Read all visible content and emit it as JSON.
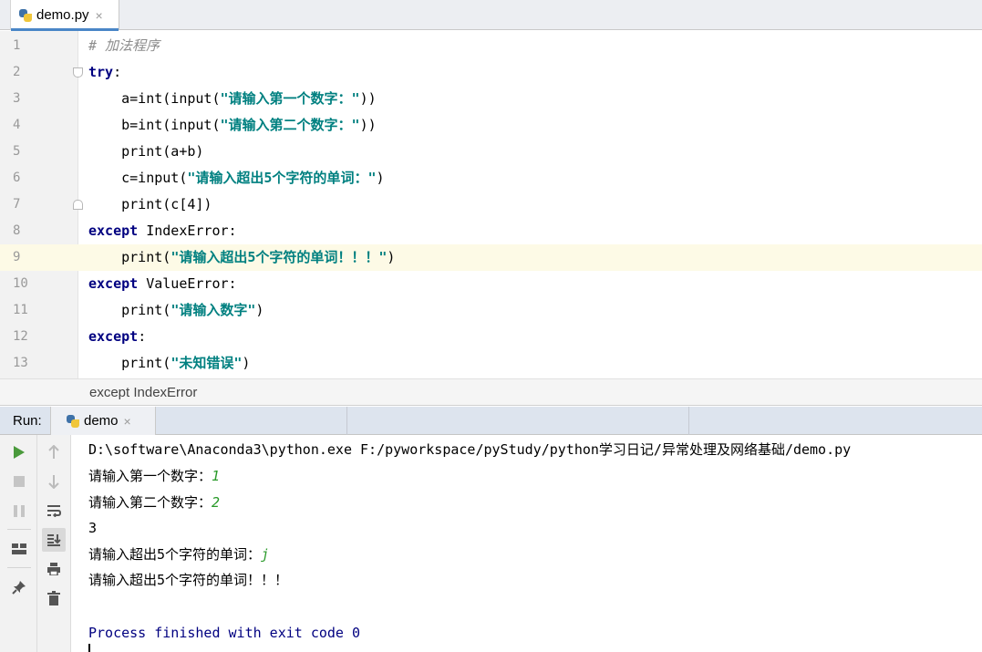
{
  "editor_tab": {
    "label": "demo.py",
    "close": "×"
  },
  "editor": {
    "lines": [
      {
        "n": "1"
      },
      {
        "n": "2"
      },
      {
        "n": "3"
      },
      {
        "n": "4"
      },
      {
        "n": "5"
      },
      {
        "n": "6"
      },
      {
        "n": "7"
      },
      {
        "n": "8"
      },
      {
        "n": "9"
      },
      {
        "n": "10"
      },
      {
        "n": "11"
      },
      {
        "n": "12"
      },
      {
        "n": "13"
      }
    ],
    "code": {
      "l1_comment": "# 加法程序",
      "l2_kw": "try",
      "l2_rest": ":",
      "l3_a": "    a=int(input(",
      "l3_s": "\"请输入第一个数字：\"",
      "l3_b": "))",
      "l4_a": "    b=int(input(",
      "l4_s": "\"请输入第二个数字：\"",
      "l4_b": "))",
      "l5": "    print(a+b)",
      "l6_a": "    c=input(",
      "l6_s": "\"请输入超出5个字符的单词：\"",
      "l6_b": ")",
      "l7": "    print(c[4])",
      "l8_kw": "except",
      "l8_rest": " IndexError:",
      "l9_a": "    print(",
      "l9_s": "\"请输入超出5个字符的单词！！！\"",
      "l9_b": ")",
      "l10_kw": "except",
      "l10_rest": " ValueError:",
      "l11_a": "    print(",
      "l11_s": "\"请输入数字\"",
      "l11_b": ")",
      "l12_kw": "except",
      "l12_rest": ":",
      "l13_a": "    print(",
      "l13_s": "\"未知错误\"",
      "l13_b": ")"
    }
  },
  "breadcrumb": "except IndexError",
  "run": {
    "label": "Run:",
    "tab_label": "demo",
    "tab_close": "×"
  },
  "console": {
    "cmd": "D:\\software\\Anaconda3\\python.exe F:/pyworkspace/pyStudy/python学习日记/异常处理及网络基础/demo.py",
    "p1": "请输入第一个数字：",
    "i1": "1",
    "p2": "请输入第二个数字：",
    "i2": "2",
    "out1": "3",
    "p3": "请输入超出5个字符的单词：",
    "i3": "j",
    "out2": "请输入超出5个字符的单词！！！",
    "finish": "Process finished with exit code 0"
  },
  "colors": {
    "keyword": "#000080",
    "string": "#008080",
    "comment": "#8c8c8c",
    "user_input": "#2a9a2a",
    "current_line": "#fdfae6"
  }
}
